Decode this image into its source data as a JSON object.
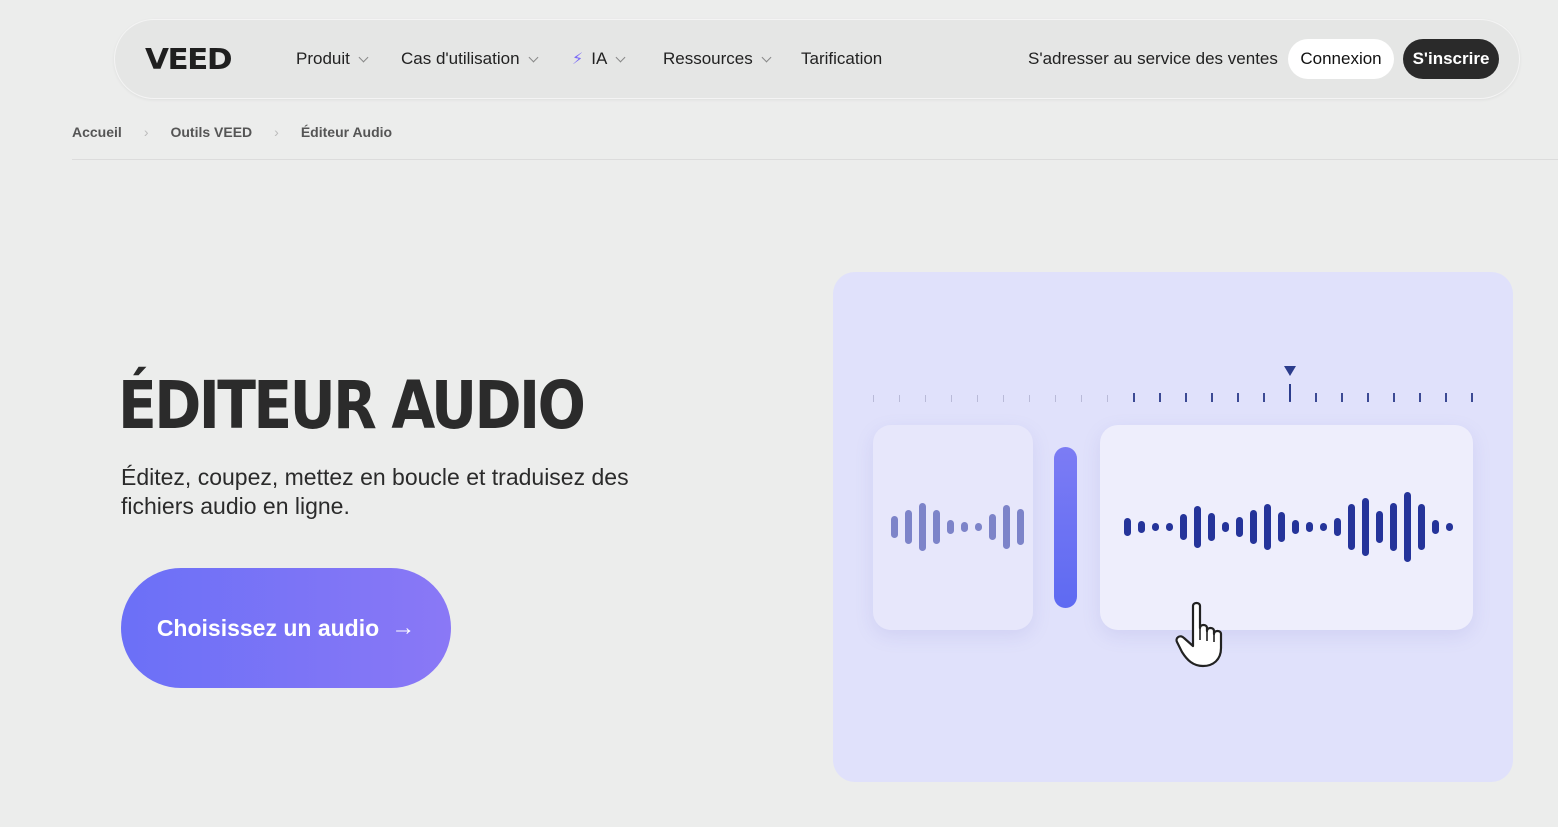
{
  "nav": {
    "logo": "VEED",
    "items": [
      {
        "label": "Produit",
        "has_dropdown": true
      },
      {
        "label": "Cas d'utilisation",
        "has_dropdown": true
      },
      {
        "label": "IA",
        "has_dropdown": true,
        "icon": "bolt-icon"
      },
      {
        "label": "Ressources",
        "has_dropdown": true
      },
      {
        "label": "Tarification",
        "has_dropdown": false
      }
    ],
    "sales_link": "S'adresser au service des ventes",
    "login_label": "Connexion",
    "signup_label": "S'inscrire"
  },
  "breadcrumb": {
    "items": [
      "Accueil",
      "Outils VEED",
      "Éditeur Audio"
    ],
    "separator": "›"
  },
  "hero": {
    "title": "ÉDITEUR AUDIO",
    "subtitle": "Éditez, coupez, mettez en boucle et traduisez des fichiers audio en ligne.",
    "cta_label": "Choisissez un audio",
    "cta_arrow": "→"
  },
  "illustration": {
    "left_clip_bars": [
      22,
      34,
      48,
      34,
      14,
      10,
      8,
      26,
      44,
      36
    ],
    "right_clip_bars": [
      18,
      12,
      8,
      8,
      26,
      42,
      28,
      10,
      20,
      34,
      46,
      30,
      14,
      10,
      8,
      18,
      46,
      58,
      32,
      48,
      70,
      46,
      14,
      8
    ],
    "colors": {
      "panel": "#e0e1fb",
      "left_wave": "#7d84c9",
      "right_wave": "#25349a",
      "handle": "#6b70f7",
      "cta": "#6b70f7",
      "accent_bolt": "#7b6cf6"
    }
  }
}
